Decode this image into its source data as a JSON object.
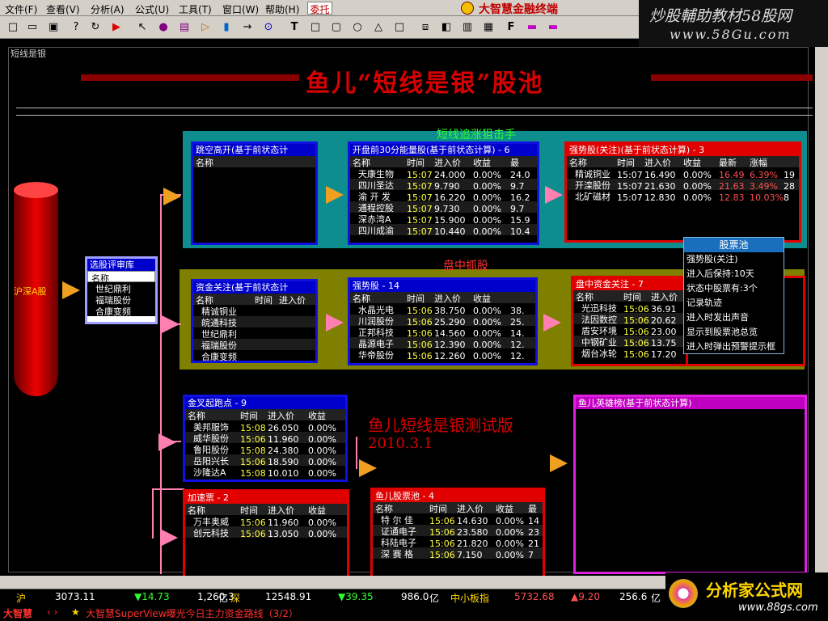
{
  "menu": {
    "items": [
      "文件(F)",
      "查看(V)",
      "分析(A)",
      "公式(U)",
      "工具(T)",
      "窗口(W)",
      "帮助(H)"
    ],
    "special": "委托",
    "app_title": "大智慧金融终端"
  },
  "watermark": {
    "line1": "炒股輔助教材58股网",
    "line2": "www.58Gu.com"
  },
  "toolbar": {
    "icons": [
      "new-icon",
      "open-icon",
      "save-icon",
      "help-icon",
      "refresh-icon",
      "play-icon",
      "cursor-icon",
      "cylinder-icon",
      "list-icon",
      "arrow-right-icon",
      "delete-icon",
      "line-arrow-icon",
      "link-icon",
      "text-icon",
      "rect-icon",
      "round-rect-icon",
      "ellipse-icon",
      "triangle-icon",
      "rect2-icon",
      "bracket-icon",
      "paint-icon",
      "fill-icon",
      "frame-icon",
      "font-icon",
      "color-icon",
      "palette-icon"
    ],
    "text_tool": "T",
    "font_tool": "F"
  },
  "workspace": {
    "label": "短线是银",
    "title": "鱼儿“短线是银”股池",
    "zone1_label": "短线追涨狙击手",
    "zone2_label": "盘中抓股",
    "source_label": "沪深A股",
    "test_version": "鱼儿短线是银测试版",
    "test_date": "2010.3.1"
  },
  "colors": {
    "teal_zone": "#0e8d8e",
    "olive_zone": "#7f7f00",
    "blue_border": "#1010e0",
    "red_border": "#e00000",
    "magenta_border": "#e020e0"
  },
  "panels": {
    "gapup": {
      "title": "跳空高开(基于前状态计",
      "head": [
        "名称"
      ],
      "rows": []
    },
    "first30": {
      "title": "开盘前30分能量股(基于前状态计算) - 6",
      "head": [
        "名称",
        "时间",
        "进入价",
        "收益",
        "最"
      ],
      "rows": [
        [
          "天康生物",
          "15:07",
          "24.000",
          "0.00%",
          "24.0"
        ],
        [
          "四川圣达",
          "15:07",
          "9.790",
          "0.00%",
          "9.7"
        ],
        [
          "渝 开 发",
          "15:07",
          "16.220",
          "0.00%",
          "16.2"
        ],
        [
          "通程控股",
          "15:07",
          "9.730",
          "0.00%",
          "9.7"
        ],
        [
          "深赤湾A",
          "15:07",
          "15.900",
          "0.00%",
          "15.9"
        ],
        [
          "四川成渝",
          "15:07",
          "10.440",
          "0.00%",
          "10.4"
        ]
      ]
    },
    "strong_watch": {
      "title": "强势股(关注)(基于前状态计算) - 3",
      "head": [
        "名称",
        "时间",
        "进入价",
        "收益",
        "最新",
        "涨幅",
        ""
      ],
      "rows": [
        [
          "精诚铜业",
          "15:07",
          "16.490",
          "0.00%",
          "16.49",
          "6.39%",
          "19"
        ],
        [
          "开滦股份",
          "15:07",
          "21.630",
          "0.00%",
          "21.63",
          "3.49%",
          "28"
        ],
        [
          "北矿磁材",
          "15:07",
          "12.830",
          "0.00%",
          "12.83",
          "10.03%",
          "8"
        ]
      ]
    },
    "pool_select": {
      "title": "选股评审库",
      "rows": [
        "名称",
        "世纪鼎利",
        "福瑞股份",
        "合康变频"
      ]
    },
    "fund_watch": {
      "title": "资金关注(基于前状态计",
      "head": [
        "名称",
        "时间",
        "进入价"
      ],
      "rows": [
        "精诚铜业",
        "皖通科技",
        "世纪鼎利",
        "福瑞股份",
        "合康变频"
      ]
    },
    "strong14": {
      "title": "强势股 - 14",
      "head": [
        "名称",
        "时间",
        "进入价",
        "收益",
        ""
      ],
      "rows": [
        [
          "水晶光电",
          "15:06",
          "38.750",
          "0.00%",
          "38."
        ],
        [
          "川润股份",
          "15:06",
          "25.290",
          "0.00%",
          "25."
        ],
        [
          "正邦科技",
          "15:06",
          "14.560",
          "0.00%",
          "14."
        ],
        [
          "晶源电子",
          "15:06",
          "12.390",
          "0.00%",
          "12."
        ],
        [
          "华帝股份",
          "15:06",
          "12.260",
          "0.00%",
          "12."
        ]
      ]
    },
    "midday_fund": {
      "title": "盘中资金关注 - 7",
      "head": [
        "名称",
        "时间",
        "进入价"
      ],
      "rows": [
        [
          "光迅科技",
          "15:06",
          "36.91"
        ],
        [
          "法因数控",
          "15:06",
          "20.62"
        ],
        [
          "盾安环境",
          "15:06",
          "23.00"
        ],
        [
          "中钢矿业",
          "15:06",
          "13.75"
        ],
        [
          "烟台冰轮",
          "15:06",
          "17.20"
        ]
      ]
    },
    "golden_cross": {
      "title": "金叉起跑点 - 9",
      "head": [
        "名称",
        "时间",
        "进入价",
        "收益"
      ],
      "rows": [
        [
          "美邦服饰",
          "15:08",
          "26.050",
          "0.00%"
        ],
        [
          "威华股份",
          "15:06",
          "11.960",
          "0.00%"
        ],
        [
          "鲁阳股份",
          "15:08",
          "24.380",
          "0.00%"
        ],
        [
          "岳阳兴长",
          "15:06",
          "18.590",
          "0.00%"
        ],
        [
          "沙隆达A",
          "15:08",
          "10.010",
          "0.00%"
        ]
      ]
    },
    "speedup": {
      "title": "加速票 - 2",
      "head": [
        "名称",
        "时间",
        "进入价",
        "收益"
      ],
      "rows": [
        [
          "万丰奥威",
          "15:06",
          "11.960",
          "0.00%"
        ],
        [
          "创元科技",
          "15:06",
          "13.050",
          "0.00%"
        ]
      ]
    },
    "fish_pool": {
      "title": "鱼儿股票池 - 4",
      "head": [
        "名称",
        "时间",
        "进入价",
        "收益",
        "最"
      ],
      "rows": [
        [
          "特 尔 佳",
          "15:06",
          "14.630",
          "0.00%",
          "14"
        ],
        [
          "证通电子",
          "15:06",
          "23.580",
          "0.00%",
          "23"
        ],
        [
          "科陆电子",
          "15:06",
          "21.820",
          "0.00%",
          "21"
        ],
        [
          "深 赛 格",
          "15:06",
          "7.150",
          "0.00%",
          "7"
        ]
      ]
    },
    "hero": {
      "title": "鱼儿英雄榜(基于前状态计算)"
    }
  },
  "popup": {
    "title": "股票池",
    "items": [
      "强势股(关注)",
      "进入后保持:10天",
      "状态中股票有:3个",
      "记录轨迹",
      "进入时发出声音",
      "显示到股票池总览",
      "进入时弹出预警提示框"
    ]
  },
  "status": {
    "sh_label": "沪",
    "sh_value": "3073.11",
    "sh_change": "▼14.73",
    "sh_amount": "1,260.3",
    "sz_label": "深",
    "sz_value": "12548.91",
    "sz_change": "▼39.35",
    "sz_amount": "986.0",
    "sme_label": "中小板指",
    "sme_value": "5732.68",
    "sme_change": "▲9.20",
    "sme_amount": "256.6",
    "yi": "亿",
    "yi2": "亿",
    "yi3": "亿"
  },
  "news": {
    "logo": "大智慧",
    "nav": "‹ ›",
    "star": "★",
    "text": "大智慧SuperView曝光今日主力资金路线（3/2）"
  },
  "brand": {
    "name": "分析家公式网",
    "url": "www.88gs.com"
  }
}
